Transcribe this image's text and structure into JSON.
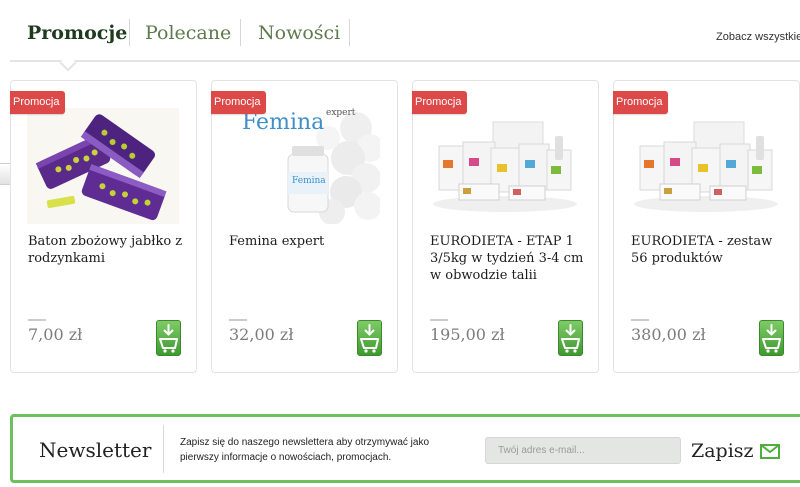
{
  "tabs": [
    {
      "label": "Promocje",
      "active": true
    },
    {
      "label": "Polecane",
      "active": false
    },
    {
      "label": "Nowości",
      "active": false
    }
  ],
  "see_all": "Zobacz wszystkie",
  "carousel": {
    "prev_icon": "arrow-left-icon",
    "next_icon": "arrow-right-icon"
  },
  "products": [
    {
      "badge": "Promocja",
      "name": "Baton zbożowy jabłko z rodzynkami",
      "price": "7,00 zł",
      "image": "purple-cereal-bars"
    },
    {
      "badge": "Promocja",
      "name": "Femina expert",
      "price": "32,00 zł",
      "image": "femina-expert-bottle"
    },
    {
      "badge": "Promocja",
      "name": "EURODIETA - ETAP 1 3/5kg w tydzień 3-4 cm w obwodzie talii",
      "price": "195,00 zł",
      "image": "eurodieta-boxes"
    },
    {
      "badge": "Promocja",
      "name": "EURODIETA - zestaw 56 produktów",
      "price": "380,00 zł",
      "image": "eurodieta-boxes"
    }
  ],
  "image_text": {
    "femina_brand": "Femina",
    "femina_sup": "expert",
    "femina_bottle": "Femina"
  },
  "newsletter": {
    "title": "Newsletter",
    "description": "Zapisz się do naszego newslettera aby otrzymywać jako pierwszy informacje o nowościach, promocjach.",
    "email_placeholder": "Twój adres e-mail...",
    "submit_label": "Zapisz",
    "submit_icon": "envelope-icon"
  },
  "colors": {
    "accent_green": "#6cc05d",
    "badge_red": "#dd4848",
    "cart_green": "#4fae3c"
  }
}
